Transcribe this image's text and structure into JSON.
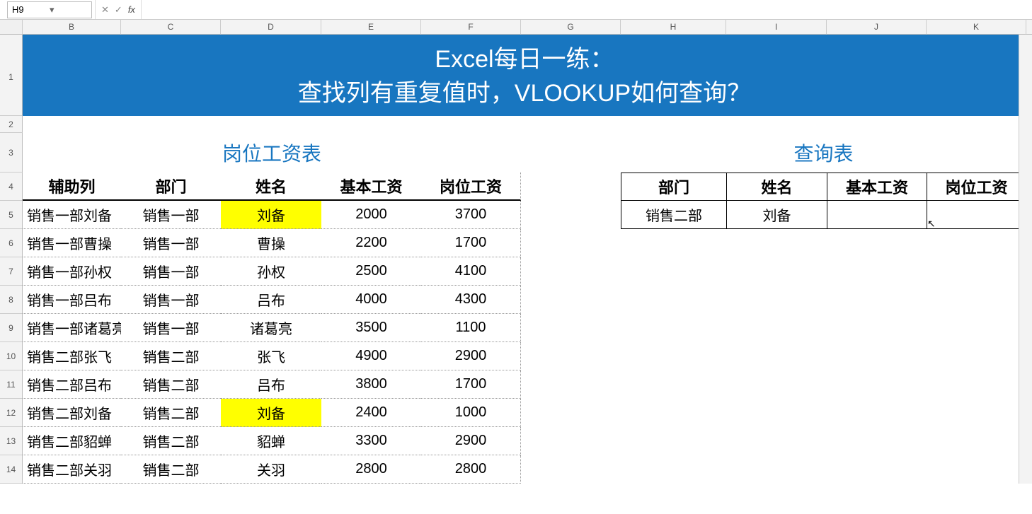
{
  "formula_bar": {
    "name_box": "H9",
    "cancel": "✕",
    "confirm": "✓",
    "fx": "fx",
    "down": "▾",
    "value": ""
  },
  "columns": [
    "",
    "B",
    "C",
    "D",
    "E",
    "F",
    "G",
    "H",
    "I",
    "J",
    "K",
    ""
  ],
  "title": {
    "line1": "Excel每日一练：",
    "line2": "查找列有重复值时，VLOOKUP如何查询？"
  },
  "section_titles": {
    "salary": "岗位工资表",
    "lookup": "查询表"
  },
  "salary_headers": [
    "辅助列",
    "部门",
    "姓名",
    "基本工资",
    "岗位工资"
  ],
  "salary_rows": [
    {
      "aux": "销售一部刘备",
      "dept": "销售一部",
      "name": "刘备",
      "base": "2000",
      "post": "3700",
      "hl": true
    },
    {
      "aux": "销售一部曹操",
      "dept": "销售一部",
      "name": "曹操",
      "base": "2200",
      "post": "1700",
      "hl": false
    },
    {
      "aux": "销售一部孙权",
      "dept": "销售一部",
      "name": "孙权",
      "base": "2500",
      "post": "4100",
      "hl": false
    },
    {
      "aux": "销售一部吕布",
      "dept": "销售一部",
      "name": "吕布",
      "base": "4000",
      "post": "4300",
      "hl": false
    },
    {
      "aux": "销售一部诸葛亮",
      "dept": "销售一部",
      "name": "诸葛亮",
      "base": "3500",
      "post": "1100",
      "hl": false
    },
    {
      "aux": "销售二部张飞",
      "dept": "销售二部",
      "name": "张飞",
      "base": "4900",
      "post": "2900",
      "hl": false
    },
    {
      "aux": "销售二部吕布",
      "dept": "销售二部",
      "name": "吕布",
      "base": "3800",
      "post": "1700",
      "hl": false
    },
    {
      "aux": "销售二部刘备",
      "dept": "销售二部",
      "name": "刘备",
      "base": "2400",
      "post": "1000",
      "hl": true
    },
    {
      "aux": "销售二部貂蝉",
      "dept": "销售二部",
      "name": "貂蝉",
      "base": "3300",
      "post": "2900",
      "hl": false
    },
    {
      "aux": "销售二部关羽",
      "dept": "销售二部",
      "name": "关羽",
      "base": "2800",
      "post": "2800",
      "hl": false
    }
  ],
  "lookup_headers": [
    "部门",
    "姓名",
    "基本工资",
    "岗位工资"
  ],
  "lookup_row": {
    "dept": "销售二部",
    "name": "刘备",
    "base": "",
    "post": ""
  }
}
